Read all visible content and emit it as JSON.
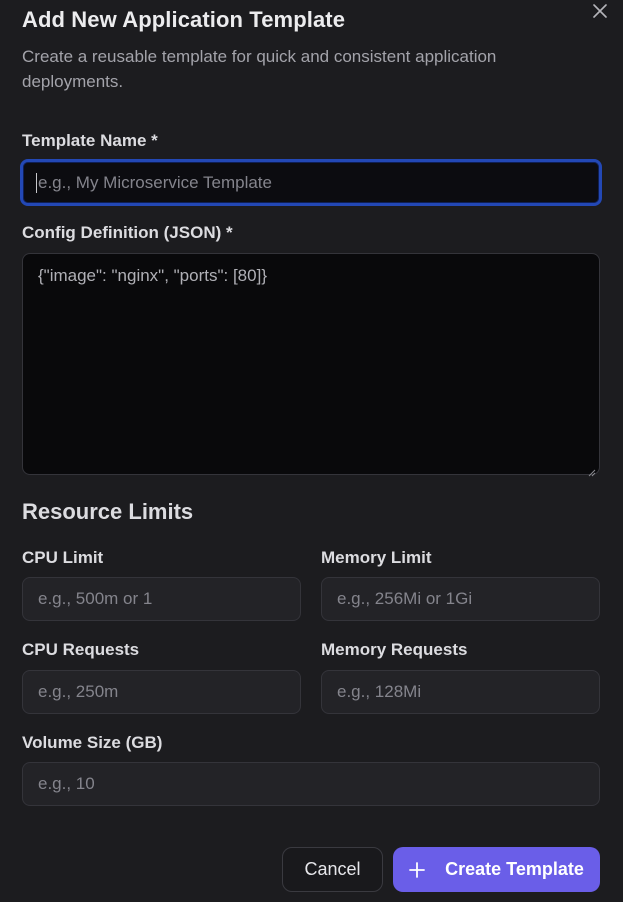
{
  "dialog": {
    "title": "Add New Application Template",
    "description": "Create a reusable template for quick and consistent application deployments.",
    "close_icon": "close-icon"
  },
  "template_name": {
    "label": "Template Name *",
    "placeholder": "e.g., My Microservice Template",
    "value": ""
  },
  "config": {
    "label": "Config Definition (JSON) *",
    "placeholder": "{\"image\": \"nginx\", \"ports\": [80]}"
  },
  "resources": {
    "heading": "Resource Limits",
    "cpu_limit": {
      "label": "CPU Limit",
      "placeholder": "e.g., 500m or 1"
    },
    "memory_limit": {
      "label": "Memory Limit",
      "placeholder": "e.g., 256Mi or 1Gi"
    },
    "cpu_requests": {
      "label": "CPU Requests",
      "placeholder": "e.g., 250m"
    },
    "memory_requests": {
      "label": "Memory Requests",
      "placeholder": "e.g., 128Mi"
    },
    "volume_size": {
      "label": "Volume Size (GB)",
      "placeholder": "e.g., 10"
    }
  },
  "actions": {
    "cancel_label": "Cancel",
    "create_label": "Create Template",
    "create_icon": "plus-icon"
  },
  "colors": {
    "accent": "#6a5ee8",
    "focus_ring": "#2348b5",
    "background": "#1c1c1f"
  }
}
